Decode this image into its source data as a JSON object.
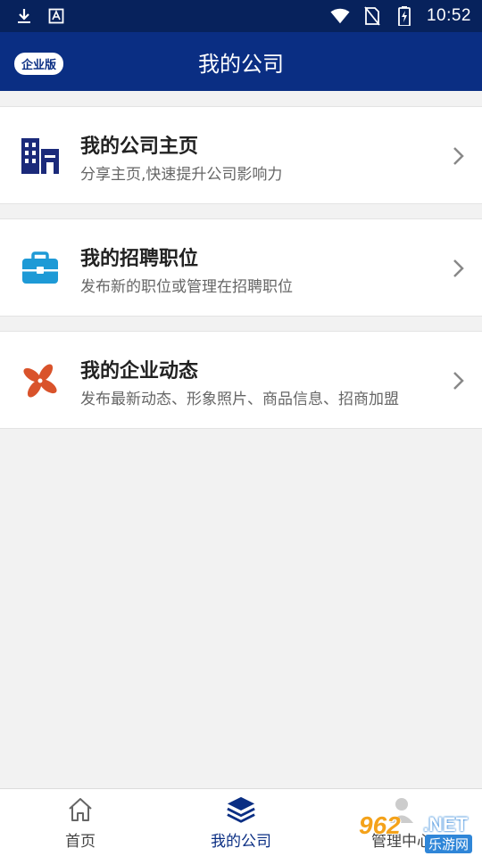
{
  "status_bar": {
    "time": "10:52",
    "icons": [
      "download-icon",
      "app-icon",
      "wifi-icon",
      "no-sim-icon",
      "battery-charging-icon"
    ]
  },
  "header": {
    "badge": "企业版",
    "title": "我的公司"
  },
  "cards": [
    {
      "title": "我的公司主页",
      "subtitle": "分享主页,快速提升公司影响力",
      "icon": "building-icon"
    },
    {
      "title": "我的招聘职位",
      "subtitle": "发布新的职位或管理在招聘职位",
      "icon": "briefcase-icon"
    },
    {
      "title": "我的企业动态",
      "subtitle": "发布最新动态、形象照片、商品信息、招商加盟",
      "icon": "pinwheel-icon"
    }
  ],
  "bottom_nav": {
    "items": [
      {
        "label": "首页",
        "icon": "home-icon"
      },
      {
        "label": "我的公司",
        "icon": "layers-icon",
        "active": true
      },
      {
        "label": "管理中心",
        "icon": "person-icon"
      }
    ]
  },
  "watermark": {
    "number": "962",
    "suffix": ".NET",
    "site": "乐游网"
  },
  "colors": {
    "header_bg": "#0a2e83",
    "status_bg": "#07225c",
    "accent_blue": "#1e9ad6",
    "accent_red": "#d9532b"
  }
}
